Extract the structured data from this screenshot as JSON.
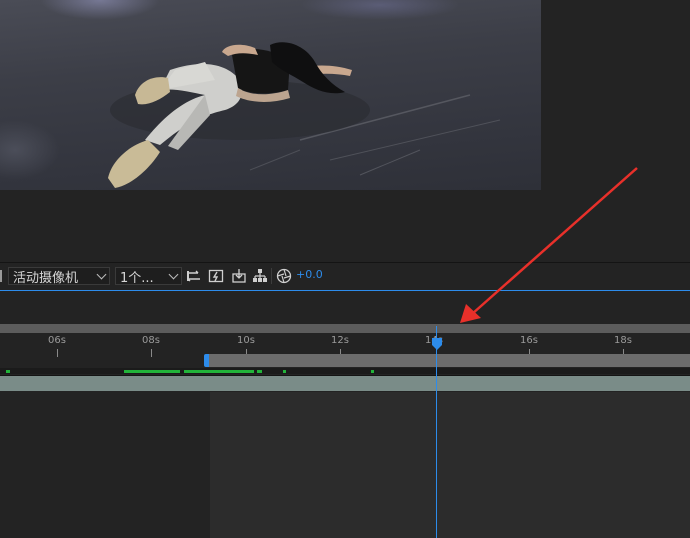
{
  "toolbar": {
    "camera_select": {
      "value": "活动摄像机"
    },
    "views_select": {
      "value": "1个..."
    },
    "exposure_value": "+0.0",
    "icons": [
      "resolution-icon",
      "snapshot-icon",
      "region-icon",
      "channels-icon",
      "reset-exposure-icon"
    ]
  },
  "ruler": {
    "labels": [
      "06s",
      "08s",
      "10s",
      "12s",
      "14s",
      "16s",
      "18s"
    ],
    "playhead_label": "14s"
  },
  "colors": {
    "accent_blue": "#2d8ceb",
    "cache_green": "#22b33a",
    "layer_bar": "#7a8c88",
    "annotation_red": "#e8302a"
  }
}
